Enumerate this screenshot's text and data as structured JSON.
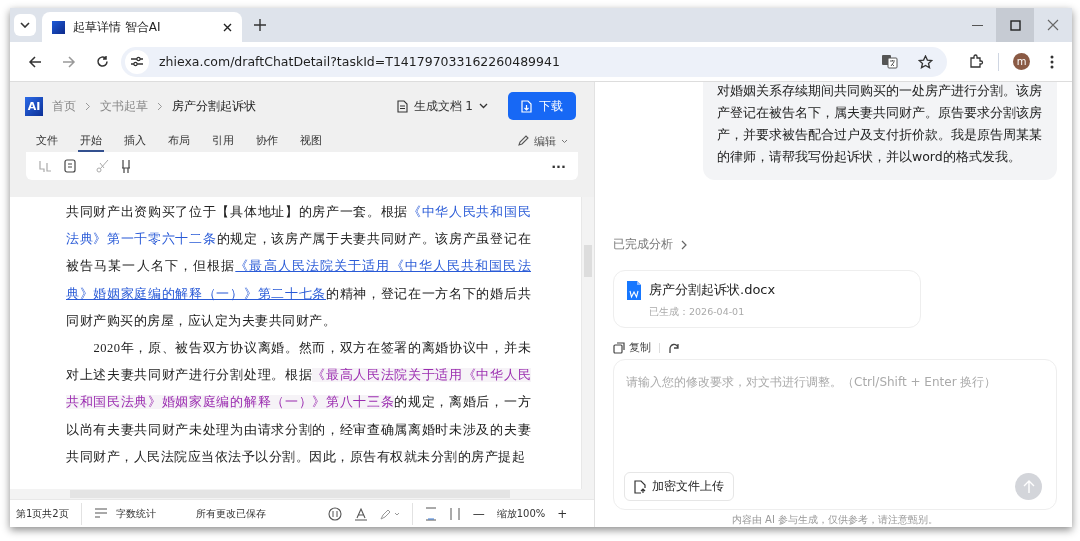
{
  "browser": {
    "tab_title": "起草详情 智合AI",
    "url": "zhiexa.com/draftChatDetail?taskId=T141797033162260489941",
    "avatar": "m"
  },
  "header": {
    "logo": "AI",
    "breadcrumb": [
      "首页",
      "文书起草",
      "房产分割起诉状"
    ],
    "document_select": "生成文档 1",
    "download_button": "下载"
  },
  "menu_tabs": [
    {
      "label": "文件",
      "selected": false
    },
    {
      "label": "开始",
      "selected": true
    },
    {
      "label": "插入",
      "selected": false
    },
    {
      "label": "布局",
      "selected": false
    },
    {
      "label": "引用",
      "selected": false
    },
    {
      "label": "协作",
      "selected": false
    },
    {
      "label": "视图",
      "selected": false
    }
  ],
  "edit_mode": "编辑",
  "more": "···",
  "document": {
    "paragraphs": [
      {
        "indent": false,
        "lines": [
          [
            {
              "kind": "plain",
              "text": "共同财产出资购买了位于【具体地址】的房产一套。根据"
            },
            {
              "kind": "link",
              "underline": false,
              "text": "《中华人民共和国民"
            }
          ],
          [
            {
              "kind": "link",
              "underline": false,
              "text": "法典》第一千零六十二条"
            },
            {
              "kind": "plain",
              "text": "的规定，该房产属于夫妻共同财产。该房产虽登记在"
            }
          ],
          [
            {
              "kind": "plain",
              "text": "被告马某一人名下，但根据"
            },
            {
              "kind": "link",
              "underline": true,
              "text": "《最高人民法院关于适用《中华人民共和国民法"
            }
          ],
          [
            {
              "kind": "link",
              "underline": true,
              "text": "典》婚姻家庭编的解释（一）》第二十七条"
            },
            {
              "kind": "plain",
              "text": "的精神，登记在一方名下的婚后共"
            }
          ],
          [
            {
              "kind": "plain",
              "text": "同财产购买的房屋，应认定为夫妻共同财产。"
            }
          ]
        ]
      },
      {
        "indent": true,
        "lines": [
          [
            {
              "kind": "plain",
              "text": "2020年，原、被告双方协议离婚。然而，双方在签署的离婚协议中，并未"
            }
          ],
          [
            {
              "kind": "plain",
              "text": "对上述夫妻共同财产进行分割处理。根据"
            },
            {
              "kind": "visited-link",
              "underline": false,
              "text": "《最高人民法院关于适用《中华人民"
            }
          ],
          [
            {
              "kind": "visited-link",
              "underline": false,
              "text": "共和国民法典》婚姻家庭编的解释（一）》第八十三条"
            },
            {
              "kind": "plain",
              "text": "的规定，离婚后，一方"
            }
          ],
          [
            {
              "kind": "plain",
              "text": "以尚有夫妻共同财产未处理为由请求分割的，经审查确属离婚时未涉及的夫妻"
            }
          ],
          [
            {
              "kind": "plain",
              "text": "共同财产，人民法院应当依法予以分割。因此，原告有权就未分割的房产提起"
            }
          ]
        ]
      }
    ]
  },
  "status_bar": {
    "page": "第1页共2页",
    "word_count": "字数统计",
    "save_state": "所有更改已保存",
    "zoom_out": "—",
    "zoom": "缩放100%",
    "zoom_in": "+"
  },
  "chat": {
    "user_message": "对婚姻关系存续期间共同购买的一处房产进行分割。该房产登记在被告名下，属夫妻共同财产。原告要求分割该房产，并要求被告配合过户及支付折价款。我是原告周某某的律师，请帮我写份起诉状，并以word的格式发我。",
    "analysis": "已完成分析",
    "file": {
      "name": "房产分割起诉状.docx",
      "generated": "已生成：2026-04-01"
    },
    "copy": "复制",
    "input": {
      "placeholder": "请输入您的修改要求，对文书进行调整。（Ctrl/Shift + Enter 换行）",
      "upload_button": "加密文件上传",
      "send_disabled": true
    },
    "disclaimer": "内容由 AI 参与生成，仅供参考，请注意甄别。"
  }
}
